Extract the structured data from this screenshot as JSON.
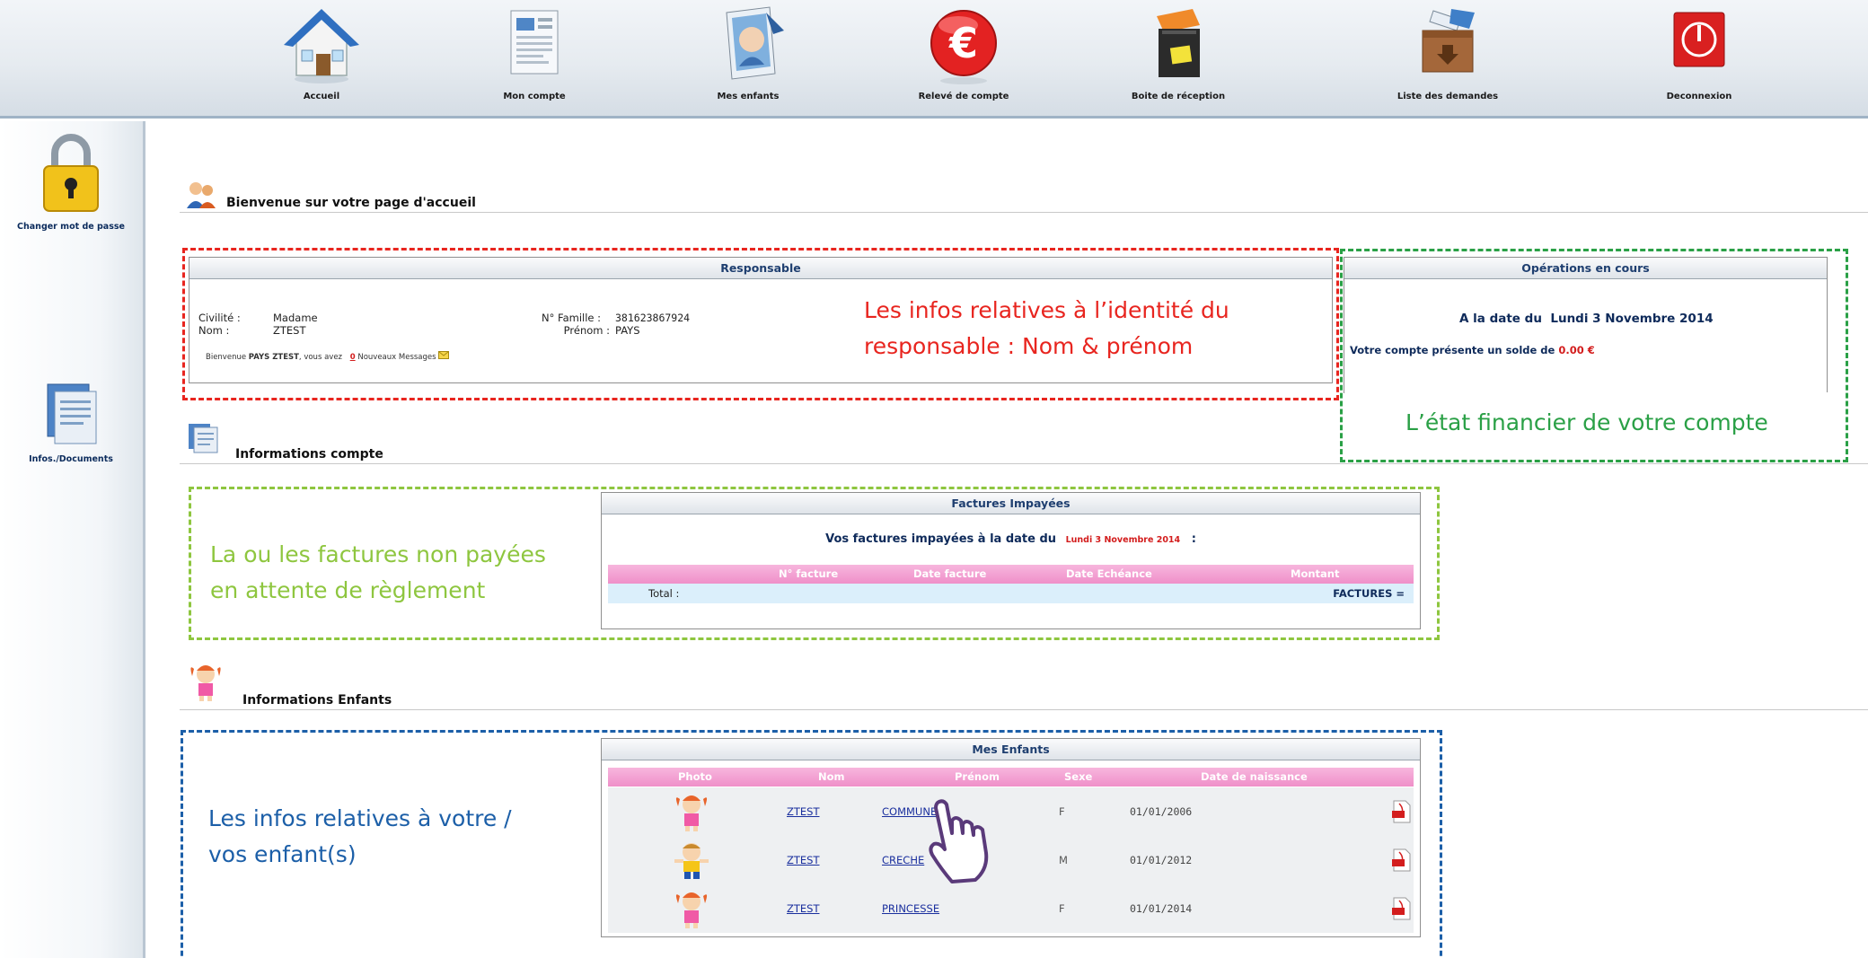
{
  "nav": {
    "items": [
      {
        "label": "Accueil",
        "icon": "house-icon"
      },
      {
        "label": "Mon compte",
        "icon": "document-icon"
      },
      {
        "label": "Mes enfants",
        "icon": "photo-icon"
      },
      {
        "label": "Relevé de compte",
        "icon": "euro-icon"
      },
      {
        "label": "Boite de réception",
        "icon": "inbox-icon"
      },
      {
        "label": "Liste des demandes",
        "icon": "requests-box-icon"
      },
      {
        "label": "Deconnexion",
        "icon": "power-icon"
      }
    ]
  },
  "sidebar": {
    "items": [
      {
        "label": "Changer mot de passe",
        "icon": "padlock-icon"
      },
      {
        "label": "Infos./Documents",
        "icon": "documents-icon"
      }
    ]
  },
  "sections": {
    "welcome": "Bienvenue sur votre page d'accueil",
    "account": "Informations compte",
    "children": "Informations Enfants"
  },
  "responsable": {
    "title": "Responsable",
    "civilite_label": "Civilité :",
    "civilite_value": "Madame",
    "nom_label": "Nom :",
    "nom_value": "ZTEST",
    "famille_label": "N° Famille :",
    "famille_value": "381623867924",
    "prenom_label": "Prénom :",
    "prenom_value": "PAYS",
    "welcome_prefix": "Bienvenue",
    "welcome_name": "PAYS ZTEST",
    "welcome_mid": ", vous avez",
    "message_count": "0",
    "message_suffix": "Nouveaux Messages"
  },
  "operations": {
    "title": "Opérations en cours",
    "date_prefix": "A la date du",
    "date_value": "Lundi 3 Novembre 2014",
    "balance_prefix": "Votre compte présente un solde de",
    "balance_value": "0.00 €"
  },
  "factures": {
    "title": "Factures Impayées",
    "intro": "Vos factures impayées à la date du",
    "intro_date": "Lundi 3 Novembre 2014",
    "intro_suffix": ":",
    "columns": [
      "N° facture",
      "Date facture",
      "Date Echéance",
      "Montant"
    ],
    "total_label": "Total :",
    "total_value": "FACTURES ="
  },
  "enfants": {
    "title": "Mes Enfants",
    "columns": [
      "Photo",
      "Nom",
      "Prénom",
      "Sexe",
      "Date de naissance"
    ],
    "rows": [
      {
        "nom": "ZTEST",
        "prenom": "COMMUNE",
        "sexe": "F",
        "naissance": "01/01/2006"
      },
      {
        "nom": "ZTEST",
        "prenom": "CRECHE",
        "sexe": "M",
        "naissance": "01/01/2012"
      },
      {
        "nom": "ZTEST",
        "prenom": "PRINCESSE",
        "sexe": "F",
        "naissance": "01/01/2014"
      }
    ]
  },
  "annotations": {
    "responsable": [
      "Les infos relatives à l’identité du",
      "responsable : Nom & prénom"
    ],
    "finance": "L’état financier de votre compte",
    "factures": [
      "La ou les factures non payées",
      "en attente de règlement"
    ],
    "enfants": [
      "Les infos relatives à votre /",
      "vos enfant(s)"
    ]
  },
  "colors": {
    "red_annotation": "#e8251f",
    "green_annotation": "#2aa046",
    "lime_annotation": "#8ec63f",
    "blue_annotation": "#1c5fa8",
    "pink_header": "#ef8fc9",
    "light_blue_row": "#dbeffb"
  }
}
